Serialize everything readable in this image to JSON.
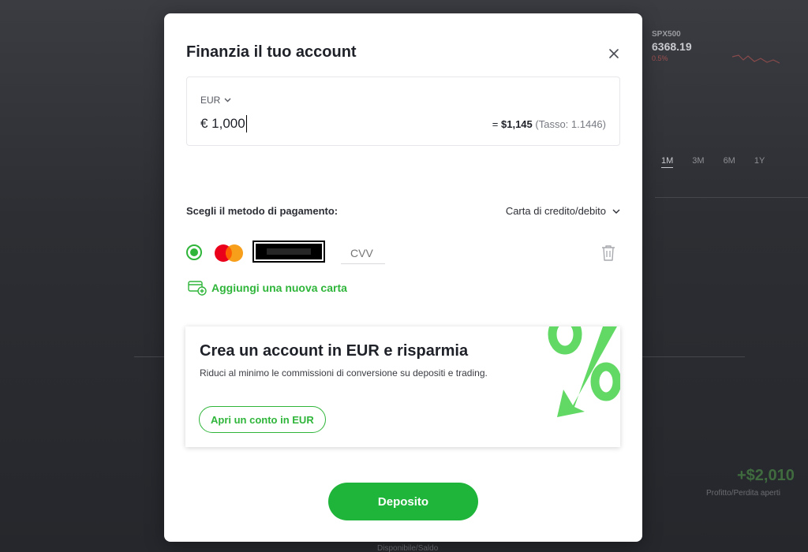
{
  "background": {
    "ticker_symbol": "SPX500",
    "ticker_price": "6368.19",
    "ticker_change": "0.5%",
    "range_tabs": [
      "1M",
      "3M",
      "6M",
      "1Y"
    ],
    "balance_value": "+$2,010",
    "balance_caption": "Profitto/Perdita aperti",
    "bottom_text": "Disponibile/Saldo"
  },
  "modal": {
    "title": "Finanzia il tuo account",
    "close_icon": "close-icon",
    "amount": {
      "currency": "EUR",
      "value": "€ 1,000",
      "converted_prefix": "= ",
      "converted_value": "$1,145",
      "rate_text": "(Tasso: 1.1446)"
    },
    "payment": {
      "label": "Scegli il metodo di pagamento:",
      "method": "Carta di credito/debito",
      "card_brand_icon": "mastercard-icon",
      "cvv_placeholder": "CVV",
      "delete_icon": "trash-icon",
      "add_card_label": "Aggiungi una nuova carta"
    },
    "promo": {
      "title": "Crea un account in EUR e risparmia",
      "text": "Riduci al minimo le commissioni di conversione su depositi e trading.",
      "button_label": "Apri un conto in EUR"
    },
    "deposit_label": "Deposito"
  },
  "colors": {
    "accent": "#1fb43a",
    "mastercard_red": "#eb001b",
    "mastercard_orange": "#f79e1b"
  }
}
